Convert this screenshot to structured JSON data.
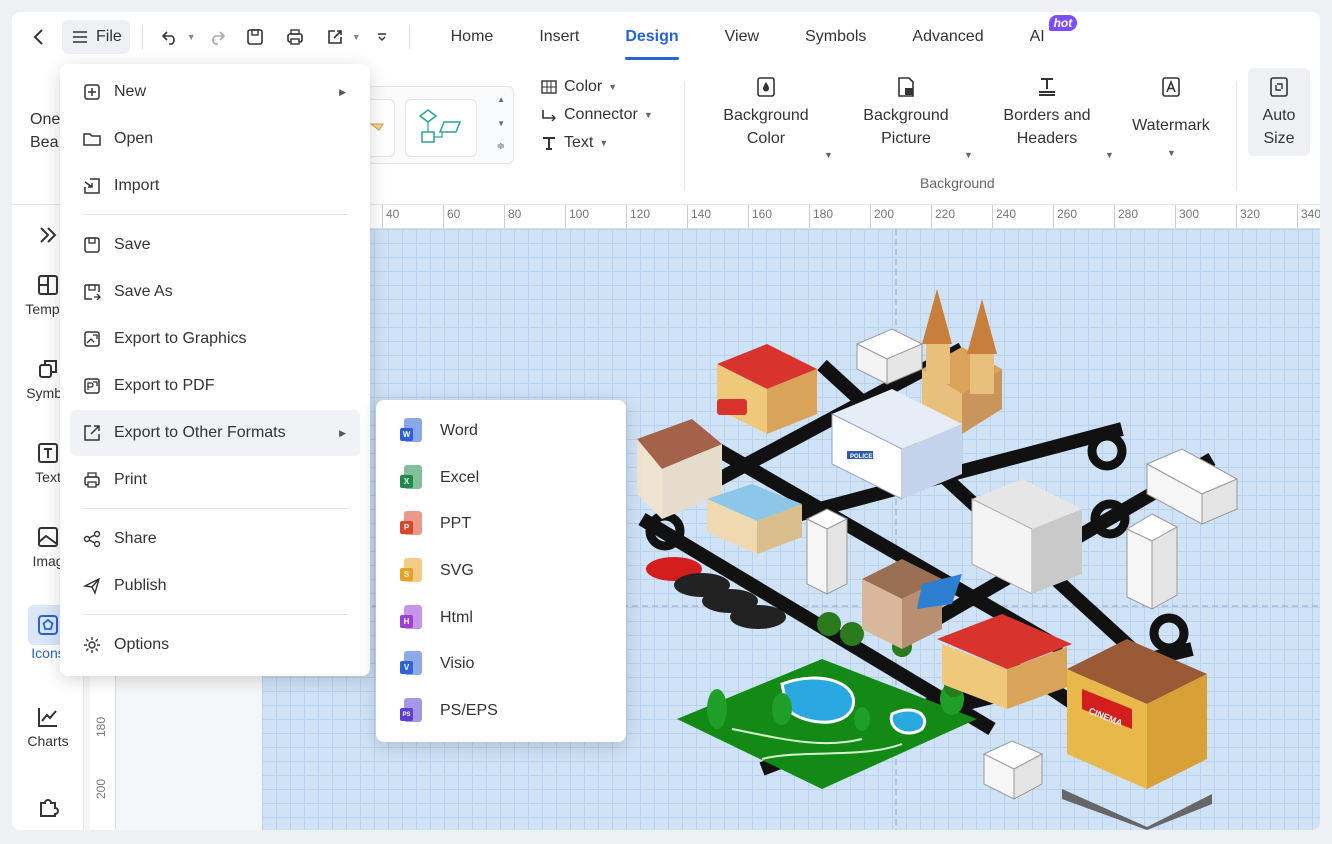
{
  "topbar": {
    "file_label": "File",
    "tabs": [
      {
        "label": "Home"
      },
      {
        "label": "Insert"
      },
      {
        "label": "Design"
      },
      {
        "label": "View"
      },
      {
        "label": "Symbols"
      },
      {
        "label": "Advanced"
      },
      {
        "label": "AI"
      }
    ],
    "active_tab": "Design",
    "hot_badge": "hot"
  },
  "ribbon": {
    "one_click_beautify_partial": [
      "One",
      "Bea"
    ],
    "color_label": "Color",
    "connector_label": "Connector",
    "text_label": "Text",
    "background_color": [
      "Background",
      "Color"
    ],
    "background_picture": [
      "Background",
      "Picture"
    ],
    "borders_headers": [
      "Borders and",
      "Headers"
    ],
    "watermark": "Watermark",
    "auto_size": [
      "Auto",
      "Size"
    ],
    "group_background": "Background"
  },
  "sidebar": {
    "items": [
      {
        "label": "",
        "icon": "expand-icon"
      },
      {
        "label": "Templa",
        "icon": "templates-icon"
      },
      {
        "label": "Symbo",
        "icon": "symbols-icon"
      },
      {
        "label": "Text",
        "icon": "text-icon"
      },
      {
        "label": "Imag",
        "icon": "image-icon"
      },
      {
        "label": "Icons",
        "icon": "icons-icon"
      },
      {
        "label": "Charts",
        "icon": "charts-icon"
      },
      {
        "label": "",
        "icon": "plugin-icon"
      }
    ]
  },
  "ruler": {
    "h_ticks": [
      "40",
      "60",
      "80",
      "100",
      "120",
      "140",
      "160",
      "180",
      "200",
      "220",
      "240",
      "260",
      "280",
      "300",
      "320",
      "340"
    ],
    "v_ticks": [
      "180",
      "200"
    ]
  },
  "file_menu": {
    "items": [
      {
        "label": "New",
        "icon": "new-icon",
        "submenu": true
      },
      {
        "label": "Open",
        "icon": "open-folder-icon"
      },
      {
        "label": "Import",
        "icon": "import-icon"
      },
      {
        "label": "Save",
        "icon": "save-icon"
      },
      {
        "label": "Save As",
        "icon": "save-as-icon"
      },
      {
        "label": "Export to Graphics",
        "icon": "export-graphics-icon"
      },
      {
        "label": "Export to PDF",
        "icon": "export-pdf-icon"
      },
      {
        "label": "Export to Other Formats",
        "icon": "export-other-icon",
        "submenu": true
      },
      {
        "label": "Print",
        "icon": "print-icon"
      },
      {
        "label": "Share",
        "icon": "share-icon"
      },
      {
        "label": "Publish",
        "icon": "publish-icon"
      },
      {
        "label": "Options",
        "icon": "gear-icon"
      }
    ]
  },
  "export_submenu": {
    "items": [
      {
        "label": "Word",
        "letter": "W",
        "color": "#2b5fd9"
      },
      {
        "label": "Excel",
        "letter": "X",
        "color": "#1f8a4c"
      },
      {
        "label": "PPT",
        "letter": "P",
        "color": "#d9472b"
      },
      {
        "label": "SVG",
        "letter": "S",
        "color": "#e8a21f"
      },
      {
        "label": "Html",
        "letter": "H",
        "color": "#9b3fd6"
      },
      {
        "label": "Visio",
        "letter": "V",
        "color": "#2f63d6"
      },
      {
        "label": "PS/EPS",
        "letter": "PS",
        "color": "#5b3fd6"
      }
    ]
  },
  "canvas_signs": {
    "police": "POLICE",
    "cinema": "CINEMA"
  },
  "colors": {
    "accent": "#2864d7",
    "canvas_bg": "#cfe2f6"
  }
}
